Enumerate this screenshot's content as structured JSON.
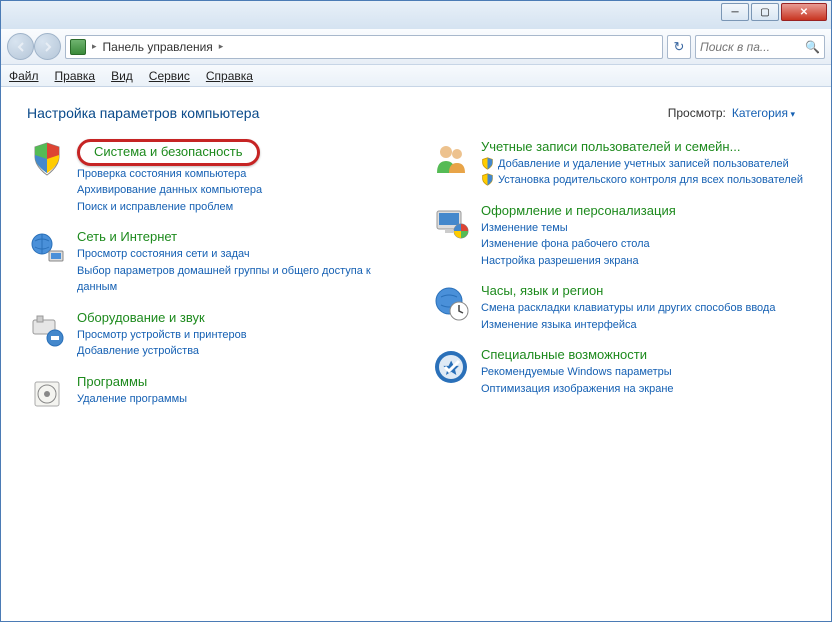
{
  "breadcrumb": {
    "root": "Панель управления",
    "separator": "▸"
  },
  "search": {
    "placeholder": "Поиск в па..."
  },
  "menu": {
    "file": "Файл",
    "edit": "Правка",
    "view": "Вид",
    "tools": "Сервис",
    "help": "Справка"
  },
  "header": {
    "title": "Настройка параметров компьютера",
    "view_label": "Просмотр:",
    "view_value": "Категория"
  },
  "left": [
    {
      "title": "Система и безопасность",
      "highlight": true,
      "subs": [
        {
          "text": "Проверка состояния компьютера"
        },
        {
          "text": "Архивирование данных компьютера"
        },
        {
          "text": "Поиск и исправление проблем"
        }
      ]
    },
    {
      "title": "Сеть и Интернет",
      "subs": [
        {
          "text": "Просмотр состояния сети и задач"
        },
        {
          "text": "Выбор параметров домашней группы и общего доступа к данным"
        }
      ]
    },
    {
      "title": "Оборудование и звук",
      "subs": [
        {
          "text": "Просмотр устройств и принтеров"
        },
        {
          "text": "Добавление устройства"
        }
      ]
    },
    {
      "title": "Программы",
      "subs": [
        {
          "text": "Удаление программы"
        }
      ]
    }
  ],
  "right": [
    {
      "title": "Учетные записи пользователей и семейн...",
      "subs": [
        {
          "text": "Добавление и удаление учетных записей пользователей",
          "shield": true
        },
        {
          "text": "Установка родительского контроля для всех пользователей",
          "shield": true
        }
      ]
    },
    {
      "title": "Оформление и персонализация",
      "subs": [
        {
          "text": "Изменение темы"
        },
        {
          "text": "Изменение фона рабочего стола"
        },
        {
          "text": "Настройка разрешения экрана"
        }
      ]
    },
    {
      "title": "Часы, язык и регион",
      "subs": [
        {
          "text": "Смена раскладки клавиатуры или других способов ввода"
        },
        {
          "text": "Изменение языка интерфейса"
        }
      ]
    },
    {
      "title": "Специальные возможности",
      "subs": [
        {
          "text": "Рекомендуемые Windows параметры"
        },
        {
          "text": "Оптимизация изображения на экране"
        }
      ]
    }
  ]
}
